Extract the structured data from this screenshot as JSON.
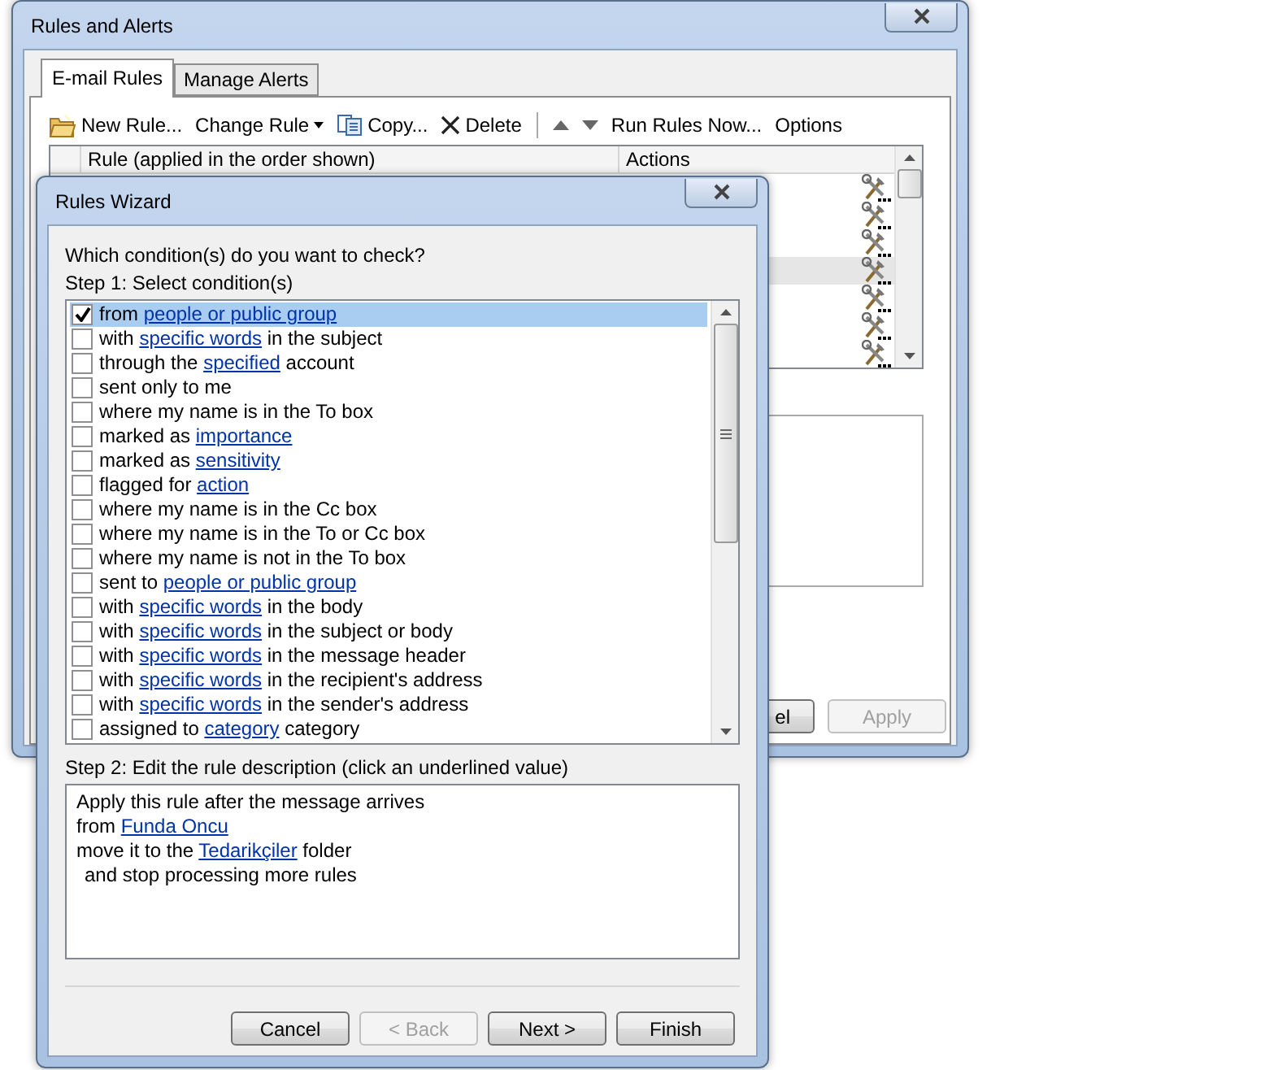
{
  "back_window": {
    "title": "Rules and Alerts",
    "tabs": [
      {
        "label": "E-mail Rules",
        "selected": true
      },
      {
        "label": "Manage Alerts",
        "selected": false
      }
    ],
    "toolbar": [
      {
        "kind": "new",
        "label": "New Rule..."
      },
      {
        "kind": "dropdown",
        "label": "Change Rule"
      },
      {
        "kind": "copy",
        "label": "Copy..."
      },
      {
        "kind": "delete",
        "label": "Delete"
      },
      {
        "kind": "separator"
      },
      {
        "kind": "up"
      },
      {
        "kind": "down"
      },
      {
        "kind": "text",
        "label": "Run Rules Now..."
      },
      {
        "kind": "text",
        "label": "Options"
      }
    ],
    "table": {
      "columns": [
        "Rule (applied in the order shown)",
        "Actions"
      ],
      "rows": [
        {
          "selected": false
        },
        {
          "selected": false
        },
        {
          "selected": false
        },
        {
          "selected": true
        },
        {
          "selected": false
        },
        {
          "selected": false
        },
        {
          "selected": false
        }
      ]
    },
    "buttons": [
      {
        "label": "el",
        "disabled": false
      },
      {
        "label": "Apply",
        "disabled": true
      }
    ]
  },
  "wizard": {
    "title": "Rules Wizard",
    "question": "Which condition(s) do you want to check?",
    "step1": "Step 1: Select condition(s)",
    "conditions": [
      {
        "checked": true,
        "selected": true,
        "segments": [
          {
            "kind": "text",
            "text": "from "
          },
          {
            "kind": "link",
            "text": "people or public group"
          }
        ]
      },
      {
        "checked": false,
        "selected": false,
        "segments": [
          {
            "kind": "text",
            "text": "with "
          },
          {
            "kind": "link",
            "text": "specific words"
          },
          {
            "kind": "text",
            "text": " in the subject"
          }
        ]
      },
      {
        "checked": false,
        "selected": false,
        "segments": [
          {
            "kind": "text",
            "text": "through the "
          },
          {
            "kind": "link",
            "text": "specified"
          },
          {
            "kind": "text",
            "text": " account"
          }
        ]
      },
      {
        "checked": false,
        "selected": false,
        "segments": [
          {
            "kind": "text",
            "text": "sent only to me"
          }
        ]
      },
      {
        "checked": false,
        "selected": false,
        "segments": [
          {
            "kind": "text",
            "text": "where my name is in the To box"
          }
        ]
      },
      {
        "checked": false,
        "selected": false,
        "segments": [
          {
            "kind": "text",
            "text": "marked as "
          },
          {
            "kind": "link",
            "text": "importance"
          }
        ]
      },
      {
        "checked": false,
        "selected": false,
        "segments": [
          {
            "kind": "text",
            "text": "marked as "
          },
          {
            "kind": "link",
            "text": "sensitivity"
          }
        ]
      },
      {
        "checked": false,
        "selected": false,
        "segments": [
          {
            "kind": "text",
            "text": "flagged for "
          },
          {
            "kind": "link",
            "text": "action"
          }
        ]
      },
      {
        "checked": false,
        "selected": false,
        "segments": [
          {
            "kind": "text",
            "text": "where my name is in the Cc box"
          }
        ]
      },
      {
        "checked": false,
        "selected": false,
        "segments": [
          {
            "kind": "text",
            "text": "where my name is in the To or Cc box"
          }
        ]
      },
      {
        "checked": false,
        "selected": false,
        "segments": [
          {
            "kind": "text",
            "text": "where my name is not in the To box"
          }
        ]
      },
      {
        "checked": false,
        "selected": false,
        "segments": [
          {
            "kind": "text",
            "text": "sent to "
          },
          {
            "kind": "link",
            "text": "people or public group"
          }
        ]
      },
      {
        "checked": false,
        "selected": false,
        "segments": [
          {
            "kind": "text",
            "text": "with "
          },
          {
            "kind": "link",
            "text": "specific words"
          },
          {
            "kind": "text",
            "text": " in the body"
          }
        ]
      },
      {
        "checked": false,
        "selected": false,
        "segments": [
          {
            "kind": "text",
            "text": "with "
          },
          {
            "kind": "link",
            "text": "specific words"
          },
          {
            "kind": "text",
            "text": " in the subject or body"
          }
        ]
      },
      {
        "checked": false,
        "selected": false,
        "segments": [
          {
            "kind": "text",
            "text": "with "
          },
          {
            "kind": "link",
            "text": "specific words"
          },
          {
            "kind": "text",
            "text": " in the message header"
          }
        ]
      },
      {
        "checked": false,
        "selected": false,
        "segments": [
          {
            "kind": "text",
            "text": "with "
          },
          {
            "kind": "link",
            "text": "specific words"
          },
          {
            "kind": "text",
            "text": " in the recipient's address"
          }
        ]
      },
      {
        "checked": false,
        "selected": false,
        "segments": [
          {
            "kind": "text",
            "text": "with "
          },
          {
            "kind": "link",
            "text": "specific words"
          },
          {
            "kind": "text",
            "text": " in the sender's address"
          }
        ]
      },
      {
        "checked": false,
        "selected": false,
        "segments": [
          {
            "kind": "text",
            "text": "assigned to "
          },
          {
            "kind": "link",
            "text": "category"
          },
          {
            "kind": "text",
            "text": " category"
          }
        ]
      }
    ],
    "step2": "Step 2: Edit the rule description (click an underlined value)",
    "description": [
      {
        "indent": false,
        "segments": [
          {
            "kind": "text",
            "text": "Apply this rule after the message arrives"
          }
        ]
      },
      {
        "indent": false,
        "segments": [
          {
            "kind": "text",
            "text": "from "
          },
          {
            "kind": "link",
            "text": "Funda Oncu"
          }
        ]
      },
      {
        "indent": false,
        "segments": [
          {
            "kind": "text",
            "text": "move it to the "
          },
          {
            "kind": "link",
            "text": "Tedarikçiler"
          },
          {
            "kind": "text",
            "text": " folder"
          }
        ]
      },
      {
        "indent": true,
        "segments": [
          {
            "kind": "text",
            "text": "and stop processing more rules"
          }
        ]
      }
    ],
    "buttons": [
      {
        "label": "Cancel",
        "disabled": false
      },
      {
        "label": "< Back",
        "disabled": true
      },
      {
        "label": "Next >",
        "disabled": false
      },
      {
        "label": "Finish",
        "disabled": false
      }
    ]
  }
}
